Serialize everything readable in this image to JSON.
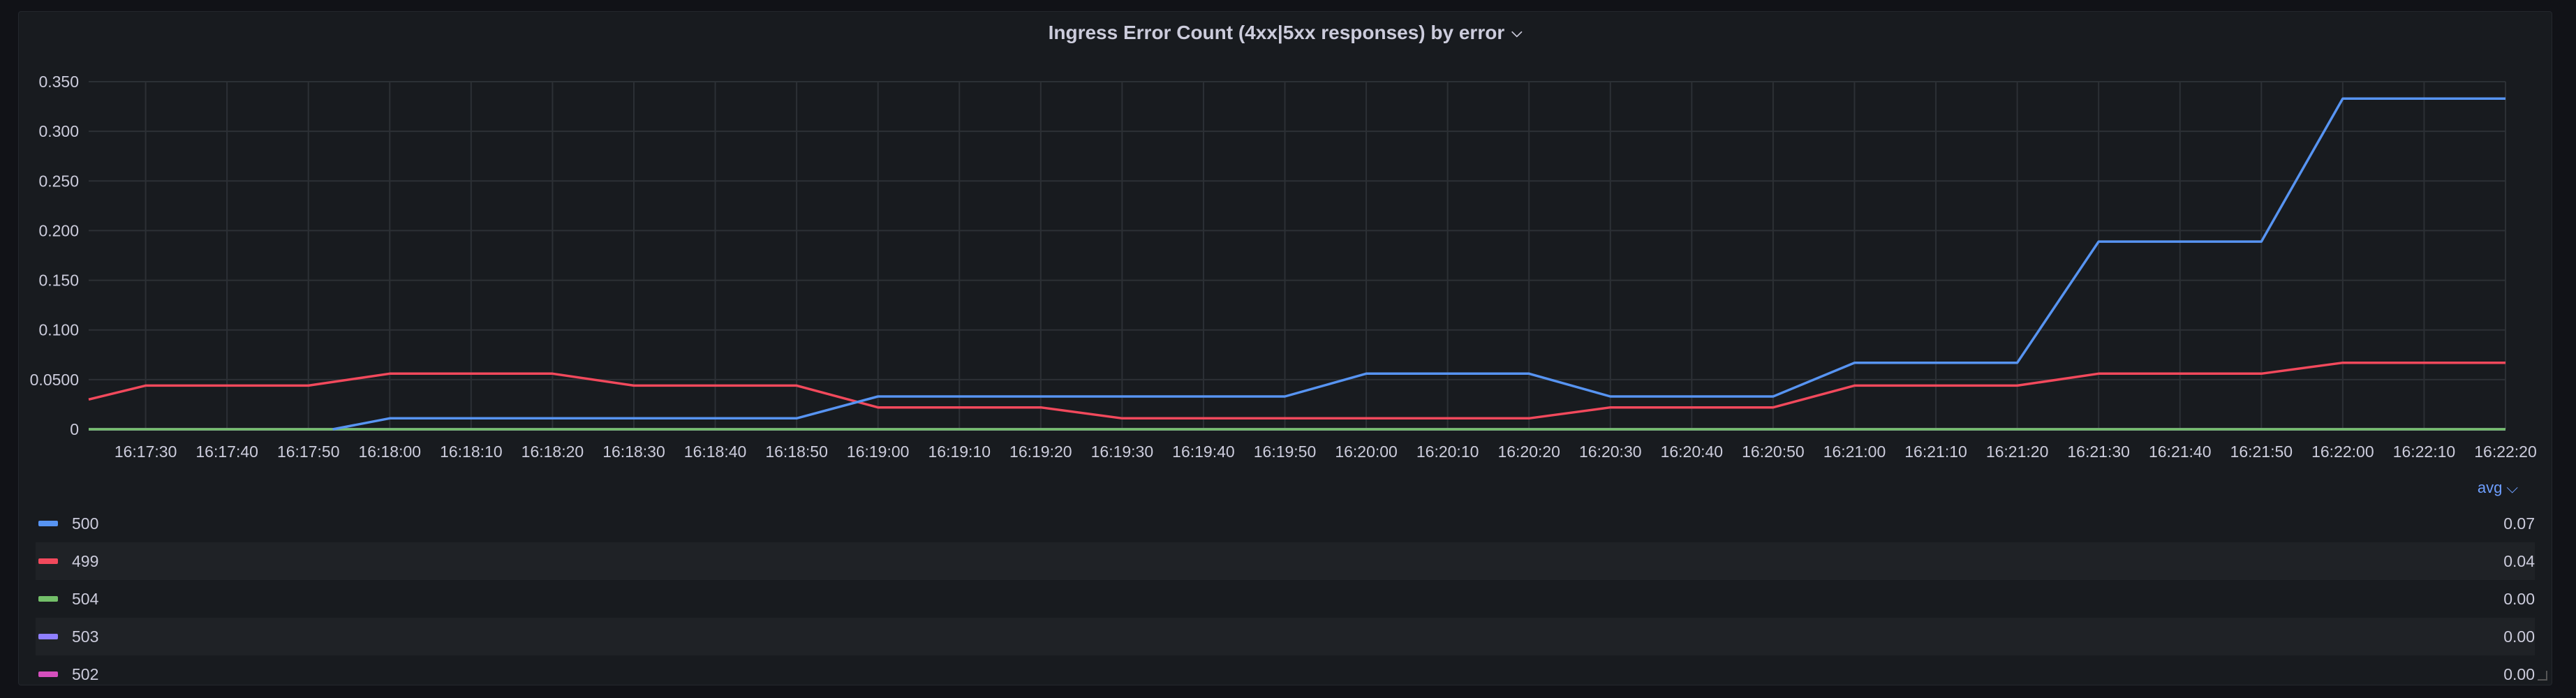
{
  "panel": {
    "title": "Ingress Error Count (4xx|5xx responses) by error",
    "title_icon": "chevron-down-icon"
  },
  "legend": {
    "header_label": "avg",
    "header_icon": "chevron-down-icon",
    "items": [
      {
        "name": "500",
        "value": "0.07",
        "color": "#5794f2"
      },
      {
        "name": "499",
        "value": "0.04",
        "color": "#f2495c"
      },
      {
        "name": "504",
        "value": "0.00",
        "color": "#73bf69"
      },
      {
        "name": "503",
        "value": "0.00",
        "color": "#8f7fff"
      },
      {
        "name": "502",
        "value": "0.00",
        "color": "#d44fbd"
      }
    ]
  },
  "chart_data": {
    "type": "line",
    "ylim": [
      0,
      0.35
    ],
    "y_ticks": [
      0,
      0.05,
      0.1,
      0.15,
      0.2,
      0.25,
      0.3,
      0.35
    ],
    "y_tick_labels": [
      "0",
      "0.0500",
      "0.100",
      "0.150",
      "0.200",
      "0.250",
      "0.300",
      "0.350"
    ],
    "x": [
      "16:17:30",
      "16:17:40",
      "16:17:50",
      "16:18:00",
      "16:18:10",
      "16:18:20",
      "16:18:30",
      "16:18:40",
      "16:18:50",
      "16:19:00",
      "16:19:10",
      "16:19:20",
      "16:19:30",
      "16:19:40",
      "16:19:50",
      "16:20:00",
      "16:20:10",
      "16:20:20",
      "16:20:30",
      "16:20:40",
      "16:20:50",
      "16:21:00",
      "16:21:10",
      "16:21:20",
      "16:21:30",
      "16:21:40",
      "16:21:50",
      "16:22:00",
      "16:22:10",
      "16:22:20"
    ],
    "xlim": [
      "16:17:23",
      "16:22:20"
    ],
    "grid": true,
    "series": [
      {
        "name": "500",
        "color": "#5794f2",
        "points": [
          [
            "16:17:53",
            0
          ],
          [
            "16:18:00",
            0.011
          ],
          [
            "16:18:50",
            0.011
          ],
          [
            "16:19:00",
            0.033
          ],
          [
            "16:19:50",
            0.033
          ],
          [
            "16:20:00",
            0.056
          ],
          [
            "16:20:20",
            0.056
          ],
          [
            "16:20:30",
            0.033
          ],
          [
            "16:20:50",
            0.033
          ],
          [
            "16:21:00",
            0.067
          ],
          [
            "16:21:20",
            0.067
          ],
          [
            "16:21:30",
            0.189
          ],
          [
            "16:21:50",
            0.189
          ],
          [
            "16:22:00",
            0.333
          ],
          [
            "16:22:20",
            0.333
          ]
        ]
      },
      {
        "name": "499",
        "color": "#f2495c",
        "points": [
          [
            "16:17:23",
            0.03
          ],
          [
            "16:17:30",
            0.044
          ],
          [
            "16:17:50",
            0.044
          ],
          [
            "16:18:00",
            0.056
          ],
          [
            "16:18:20",
            0.056
          ],
          [
            "16:18:30",
            0.044
          ],
          [
            "16:18:50",
            0.044
          ],
          [
            "16:19:00",
            0.022
          ],
          [
            "16:19:20",
            0.022
          ],
          [
            "16:19:30",
            0.011
          ],
          [
            "16:20:20",
            0.011
          ],
          [
            "16:20:30",
            0.022
          ],
          [
            "16:20:50",
            0.022
          ],
          [
            "16:21:00",
            0.044
          ],
          [
            "16:21:20",
            0.044
          ],
          [
            "16:21:30",
            0.056
          ],
          [
            "16:21:50",
            0.056
          ],
          [
            "16:22:00",
            0.067
          ],
          [
            "16:22:20",
            0.067
          ]
        ]
      },
      {
        "name": "504",
        "color": "#73bf69",
        "points": [
          [
            "16:17:23",
            0
          ],
          [
            "16:22:20",
            0
          ]
        ]
      },
      {
        "name": "503",
        "color": "#8f7fff",
        "points": [
          [
            "16:17:23",
            0
          ],
          [
            "16:22:20",
            0
          ]
        ]
      },
      {
        "name": "502",
        "color": "#d44fbd",
        "points": [
          [
            "16:17:23",
            0
          ],
          [
            "16:22:20",
            0
          ]
        ]
      }
    ]
  }
}
